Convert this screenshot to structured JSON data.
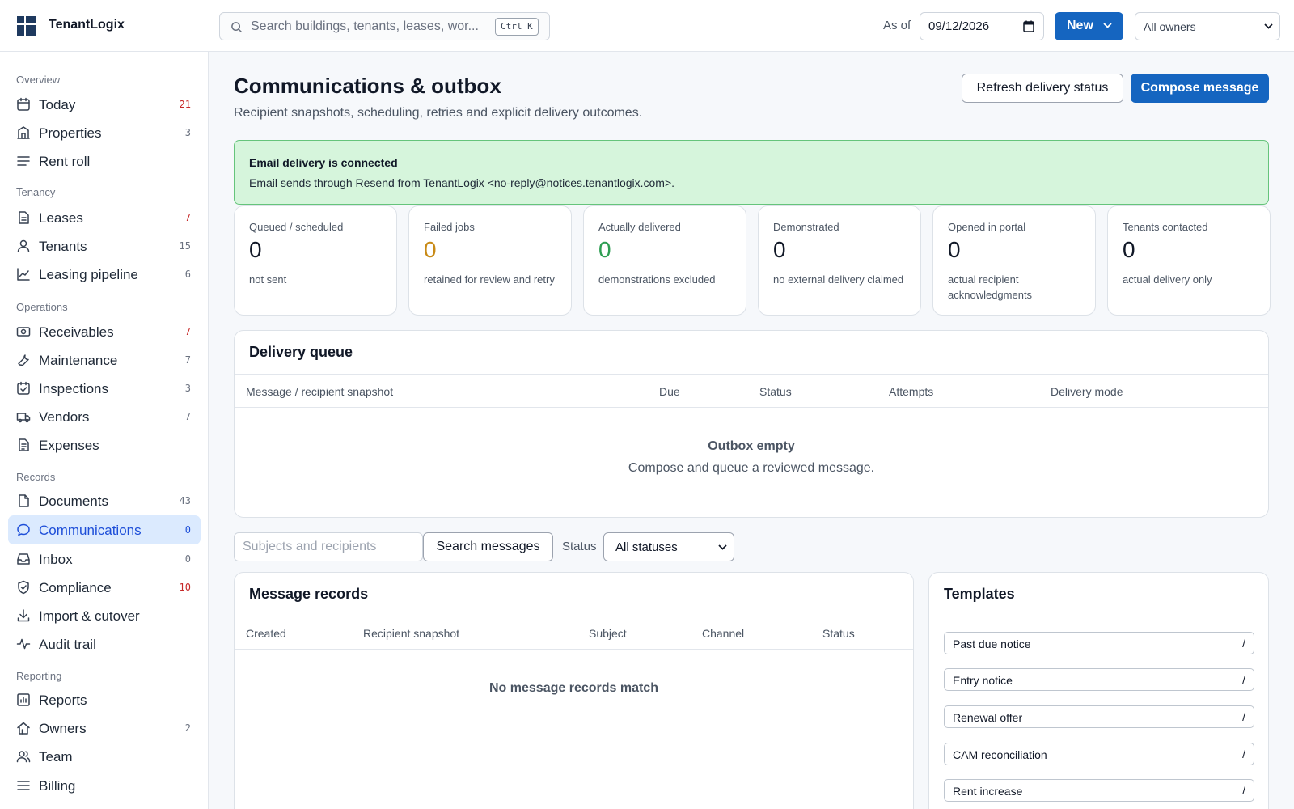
{
  "app": {
    "name": "TenantLogix"
  },
  "topbar": {
    "search_placeholder": "Search buildings, tenants, leases, wor...",
    "search_shortcut": "Ctrl K",
    "as_of_label": "As of",
    "as_of_date": "09/12/2026",
    "new_label": "New",
    "owner_filter": "All owners"
  },
  "sidebar": {
    "sections": [
      {
        "title": "Overview",
        "items": [
          {
            "label": "Today",
            "count": "21",
            "icon": "calendar-icon",
            "alert": true
          },
          {
            "label": "Properties",
            "count": "3",
            "icon": "building-icon"
          },
          {
            "label": "Rent roll",
            "count": "",
            "icon": "list-icon"
          }
        ]
      },
      {
        "title": "Tenancy",
        "items": [
          {
            "label": "Leases",
            "count": "7",
            "icon": "document-icon",
            "alert": true
          },
          {
            "label": "Tenants",
            "count": "15",
            "icon": "user-icon"
          },
          {
            "label": "Leasing pipeline",
            "count": "6",
            "icon": "chart-line-icon"
          }
        ]
      },
      {
        "title": "Operations",
        "items": [
          {
            "label": "Receivables",
            "count": "7",
            "icon": "cash-icon",
            "alert": true
          },
          {
            "label": "Maintenance",
            "count": "7",
            "icon": "wrench-icon"
          },
          {
            "label": "Inspections",
            "count": "3",
            "icon": "calendar-check-icon"
          },
          {
            "label": "Vendors",
            "count": "7",
            "icon": "truck-icon"
          },
          {
            "label": "Expenses",
            "count": "",
            "icon": "receipt-icon"
          }
        ]
      },
      {
        "title": "Records",
        "items": [
          {
            "label": "Documents",
            "count": "43",
            "icon": "file-icon"
          },
          {
            "label": "Communications",
            "count": "0",
            "icon": "message-icon",
            "active": true
          },
          {
            "label": "Inbox",
            "count": "0",
            "icon": "inbox-icon"
          },
          {
            "label": "Compliance",
            "count": "10",
            "icon": "shield-icon",
            "alert": true
          },
          {
            "label": "Import & cutover",
            "count": "",
            "icon": "download-icon"
          },
          {
            "label": "Audit trail",
            "count": "",
            "icon": "activity-icon"
          }
        ]
      },
      {
        "title": "Reporting",
        "items": [
          {
            "label": "Reports",
            "count": "",
            "icon": "report-icon"
          },
          {
            "label": "Owners",
            "count": "2",
            "icon": "home-icon"
          },
          {
            "label": "Team",
            "count": "",
            "icon": "users-icon"
          },
          {
            "label": "Billing",
            "count": "",
            "icon": "billing-icon"
          }
        ]
      }
    ]
  },
  "main": {
    "title": "Communications & outbox",
    "subtitle": "Recipient snapshots, scheduling, retries and explicit delivery outcomes.",
    "refresh_label": "Refresh delivery status",
    "compose_label": "Compose message",
    "banner": {
      "title": "Email delivery is connected",
      "text": "Email sends through Resend from TenantLogix <no-reply@notices.tenantlogix.com>."
    },
    "stats": [
      {
        "label": "Queued / scheduled",
        "value": "0",
        "note": "not sent",
        "tone": "default"
      },
      {
        "label": "Failed jobs",
        "value": "0",
        "note": "retained for review and retry",
        "tone": "amber"
      },
      {
        "label": "Actually delivered",
        "value": "0",
        "note": "demonstrations excluded",
        "tone": "green"
      },
      {
        "label": "Demonstrated",
        "value": "0",
        "note": "no external delivery claimed",
        "tone": "default"
      },
      {
        "label": "Opened in portal",
        "value": "0",
        "note": "actual recipient acknowledgments",
        "tone": "default"
      },
      {
        "label": "Tenants contacted",
        "value": "0",
        "note": "actual delivery only",
        "tone": "default"
      }
    ],
    "queue": {
      "title": "Delivery queue",
      "columns": [
        "Message / recipient snapshot",
        "Due",
        "Status",
        "Attempts",
        "Delivery mode"
      ],
      "empty_title": "Outbox empty",
      "empty_text": "Compose and queue a reviewed message."
    },
    "filters": {
      "search_placeholder": "Subjects and recipients",
      "search_button": "Search messages",
      "status_label": "Status",
      "status_value": "All statuses"
    },
    "records": {
      "title": "Message records",
      "columns": [
        "Created",
        "Recipient snapshot",
        "Subject",
        "Channel",
        "Status"
      ],
      "empty_text": "No message records match"
    },
    "templates": {
      "title": "Templates",
      "items": [
        "Past due notice",
        "Entry notice",
        "Renewal offer",
        "CAM reconciliation",
        "Rent increase"
      ],
      "shortcut": "/"
    }
  },
  "colors": {
    "primary": "#1565c0",
    "sidebar_active_bg": "#dbeafe",
    "alert_count": "#c62828",
    "banner_bg": "#d6f5dc",
    "banner_border": "#65c47b",
    "failed_value": "#c88a16",
    "delivered_value": "#2e9e53"
  }
}
